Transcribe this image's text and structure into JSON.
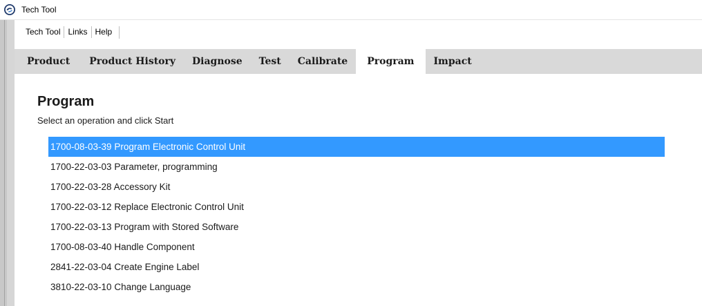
{
  "window": {
    "title": "Tech Tool"
  },
  "menu": {
    "items": [
      "Tech Tool",
      "Links",
      "Help"
    ]
  },
  "tabs": {
    "items": [
      "Product",
      "Product History",
      "Diagnose",
      "Test",
      "Calibrate",
      "Program",
      "Impact"
    ],
    "active": "Program"
  },
  "page": {
    "heading": "Program",
    "subtitle": "Select an operation and click Start"
  },
  "operations": {
    "selected_index": 0,
    "items": [
      "1700-08-03-39 Program Electronic Control Unit",
      "1700-22-03-03 Parameter, programming",
      "1700-22-03-28 Accessory Kit",
      "1700-22-03-12 Replace Electronic Control Unit",
      "1700-22-03-13 Program with Stored Software",
      "1700-08-03-40 Handle Component",
      "2841-22-03-04 Create Engine Label",
      "3810-22-03-10 Change Language"
    ]
  },
  "colors": {
    "selection": "#3399ff",
    "tabbar": "#d9d9d9",
    "frame": "#c8c8c8"
  },
  "icons": {
    "app": "tech-tool-logo-icon"
  }
}
